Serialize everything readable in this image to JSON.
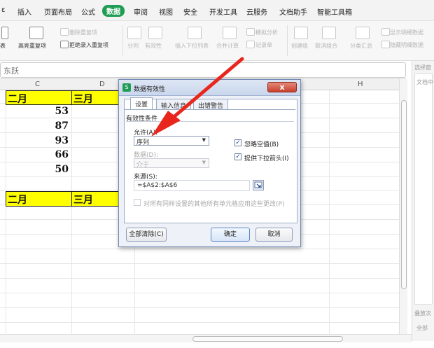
{
  "menu": {
    "items": [
      "插入",
      "页面布局",
      "公式",
      "数据",
      "审阅",
      "视图",
      "安全",
      "开发工具",
      "云服务",
      "文档助手",
      "智能工具箱"
    ],
    "active": "数据"
  },
  "ribbon": {
    "highlight_dup": "高亮重复项",
    "remove_dup": "删除重复项",
    "reject_dup": "拒绝录入重复项",
    "split": "分列",
    "validity": "有效性",
    "insert_dropdown": "插入下拉列表",
    "merge_calc": "合并计算",
    "simulate": "模拟分析",
    "record": "记录单",
    "create_group": "创建组",
    "ungroup": "取消组合",
    "subtotal": "分类汇总",
    "show_detail": "显示明细数据",
    "hide_detail": "隐藏明细数据"
  },
  "formula_bar": {
    "cell_value": "东跃"
  },
  "columns": [
    "C",
    "D",
    "H"
  ],
  "sheet": {
    "header1": {
      "c": "二月",
      "d": "三月"
    },
    "values": [
      "53",
      "87",
      "93",
      "66",
      "50"
    ],
    "header2": {
      "c": "二月",
      "d": "三月"
    }
  },
  "taskpane": {
    "title": "选择窗",
    "doc": "文档中",
    "bottom1": "叠放次",
    "bottom2": "全部"
  },
  "dialog": {
    "title": "数据有效性",
    "close": "x",
    "tabs": [
      "设置",
      "输入信息",
      "出错警告"
    ],
    "section": "有效性条件",
    "allow_label": "允许(A):",
    "allow_value": "序列",
    "data_label": "数据(D):",
    "data_value": "介于",
    "ignore_blank": "忽略空值(B)",
    "dropdown_arrow": "提供下拉箭头(I)",
    "source_label": "来源(S):",
    "source_value": "=$A$2:$A$6",
    "apply_all": "对所有同样设置的其他所有单元格应用这些更改(P)",
    "clear_all": "全部清除(C)",
    "ok": "确定",
    "cancel": "取消"
  },
  "colors": {
    "accent_green": "#1f9d55",
    "header_yellow": "#ffff00",
    "arrow_red": "#e8261c"
  }
}
